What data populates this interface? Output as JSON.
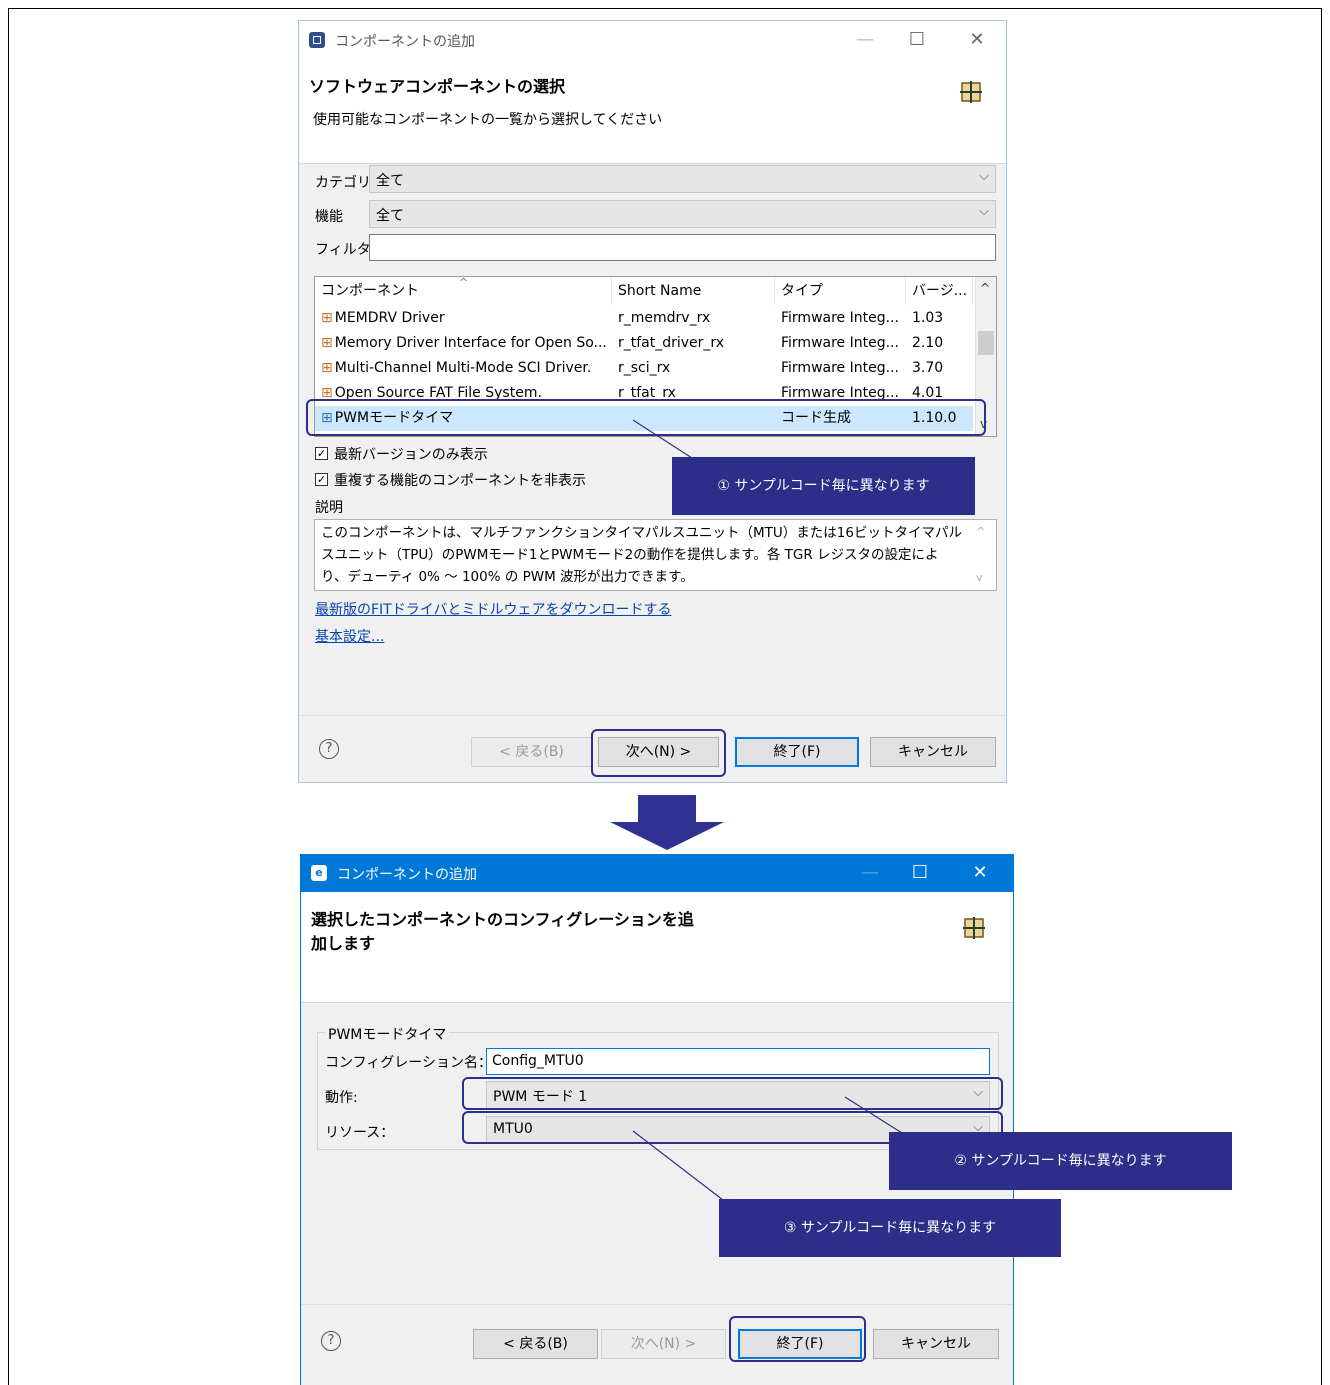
{
  "dialog1": {
    "title": "コンポーネントの追加",
    "header_title": "ソフトウェアコンポーネントの選択",
    "header_subtitle": "使用可能なコンポーネントの一覧から選択してください",
    "category_label": "カテゴリ",
    "category_value": "全て",
    "function_label": "機能",
    "function_value": "全て",
    "filter_label": "フィルタ",
    "filter_value": "",
    "table": {
      "columns": [
        "コンポーネント",
        "Short Name",
        "タイプ",
        "バージ..."
      ],
      "rows": [
        {
          "name": "MEMDRV Driver",
          "short": "r_memdrv_rx",
          "type": "Firmware Integ...",
          "version": "1.03"
        },
        {
          "name": "Memory Driver Interface for Open So...",
          "short": "r_tfat_driver_rx",
          "type": "Firmware Integ...",
          "version": "2.10"
        },
        {
          "name": "Multi-Channel Multi-Mode SCI Driver.",
          "short": "r_sci_rx",
          "type": "Firmware Integ...",
          "version": "3.70"
        },
        {
          "name": "Open Source FAT File System.",
          "short": "r_tfat_rx",
          "type": "Firmware Integ...",
          "version": "4.01"
        },
        {
          "name": "PWMモードタイマ",
          "short": "",
          "type": "コード生成",
          "version": "1.10.0"
        }
      ]
    },
    "check_latest": "最新バージョンのみ表示",
    "check_dup": "重複する機能のコンポーネントを非表示",
    "desc_label": "説明",
    "description": "このコンポーネントは、マルチファンクションタイマパルスユニット（MTU）または16ビットタイマパルスユニット（TPU）のPWMモード1とPWMモード2の動作を提供します。各 TGR レジスタの設定により、デューティ 0% ～ 100% の PWM 波形が出力できます。",
    "link_download": "最新版のFITドライバとミドルウェアをダウンロードする",
    "link_settings": "基本設定...",
    "btn_back": "< 戻る(B)",
    "btn_next": "次へ(N) >",
    "btn_finish": "終了(F)",
    "btn_cancel": "キャンセル"
  },
  "dialog2": {
    "title": "コンポーネントの追加",
    "header_title_line1": "選択したコンポーネントのコンフィグレーションを追",
    "header_title_line2": "加します",
    "group_label": "PWMモードタイマ",
    "config_name_label": "コンフィグレーション名：",
    "config_name_value": "Config_MTU0",
    "operation_label": "動作:",
    "operation_value": "PWM モード 1",
    "resource_label": "リソース：",
    "resource_value": "MTU0",
    "btn_back": "< 戻る(B)",
    "btn_next": "次へ(N) >",
    "btn_finish": "終了(F)",
    "btn_cancel": "キャンセル"
  },
  "callouts": {
    "c1": "① サンプルコード毎に異なります",
    "c2": "② サンプルコード毎に異なります",
    "c3": "③ サンプルコード毎に異なります"
  },
  "icons": {
    "window_min": "—",
    "window_max": "☐",
    "window_close": "✕",
    "help": "?",
    "checkbox": "✓",
    "combo_arrow": "⌵"
  },
  "colors": {
    "accent": "#0078d7",
    "callout_bg": "#2c2e8a",
    "selection": "#cce8ff",
    "active_titlebar": "#0078d7"
  }
}
